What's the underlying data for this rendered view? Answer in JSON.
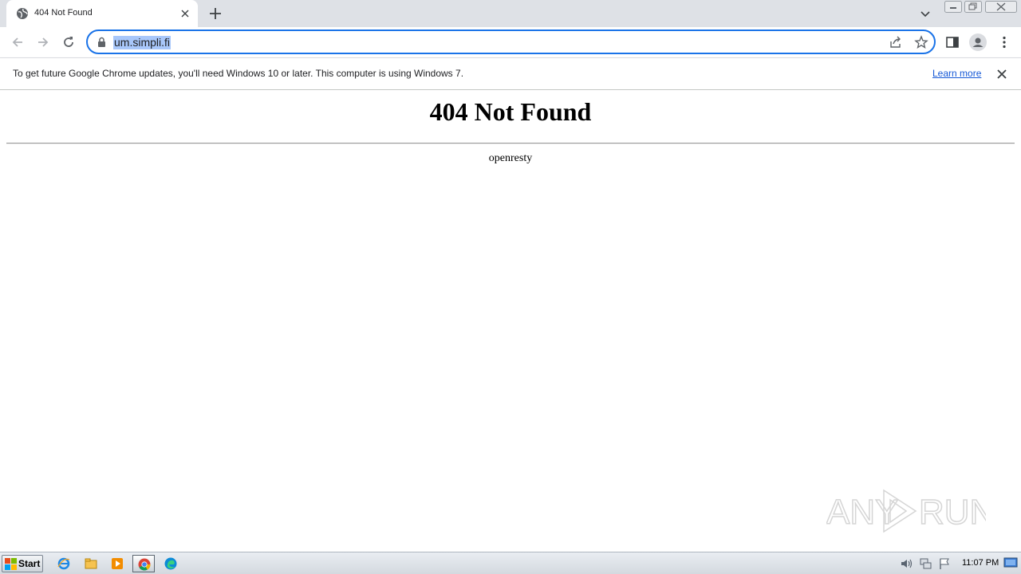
{
  "browser": {
    "tab": {
      "title": "404 Not Found",
      "favicon": "globe-icon"
    },
    "omnibox": {
      "url": "um.simpli.fi"
    },
    "accent_color": "#1a73e8"
  },
  "infobar": {
    "message": "To get future Google Chrome updates, you'll need Windows 10 or later. This computer is using Windows 7.",
    "link_label": "Learn more"
  },
  "page": {
    "heading": "404 Not Found",
    "server": "openresty"
  },
  "watermark": {
    "text_left": "ANY",
    "text_right": "RUN"
  },
  "taskbar": {
    "start_label": "Start",
    "apps": [
      "internet-explorer-icon",
      "file-explorer-icon",
      "media-player-icon",
      "chrome-icon",
      "edge-icon"
    ],
    "clock": "11:07 PM"
  }
}
